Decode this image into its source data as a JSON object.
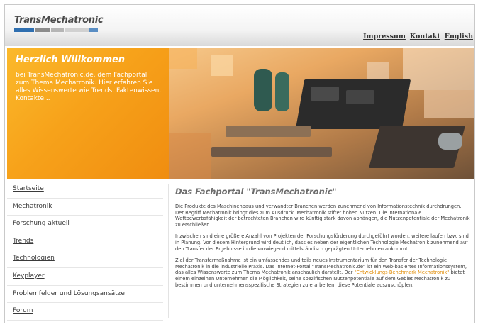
{
  "header": {
    "logo_text": "TransMechatronic",
    "links": [
      "Impressum",
      "Kontakt",
      "English"
    ]
  },
  "banner": {
    "title": "Herzlich Willkommen",
    "text": "bei TransMechatronic.de, dem Fachportal zum Thema Mechatronik. Hier erfahren Sie alles Wissenswerte wie Trends, Faktenwissen, Kontakte..."
  },
  "nav": {
    "items": [
      "Startseite",
      "Mechatronik",
      "Forschung aktuell",
      "Trends",
      "Technologien",
      "Keyplayer",
      "Problemfelder und Lösungsansätze",
      "Forum"
    ]
  },
  "content": {
    "title": "Das Fachportal \"TransMechatronic\"",
    "paragraph1": "Die Produkte des Maschinenbaus und verwandter Branchen werden zunehmend von Informationstechnik durchdrungen. Der Begriff Mechatronik bringt dies zum Ausdruck. Mechatronik stiftet hohen Nutzen. Die internationale Wettbewerbsfähigkeit der betrachteten Branchen wird künftig stark davon abhängen, die Nutzenpotentiale der Mechatronik zu erschließen.",
    "paragraph2": "Inzwischen sind eine größere Anzahl von Projekten der Forschungsförderung durchgeführt worden, weitere laufen bzw. sind in Planung. Vor diesem Hintergrund wird deutlich, dass es neben der eigentlichen Technologie Mechatronik zunehmend auf den Transfer der Ergebnisse in die vorwiegend mittelständisch geprägten Unternehmen ankommt.",
    "paragraph3_before": "Ziel der Transfermaßnahme ist ein umfassendes und teils neues Instrumentarium für den Transfer der Technologie Mechatronik in die industrielle Praxis. Das Internet-Portal \"TransMechatronic.de\" ist ein Web-basiertes Informationssystem, das alles Wissenswerte zum Thema Mechatronik anschaulich darstellt. Der ",
    "paragraph3_link": "\"Entwicklungs-Benchmark Mechatronik\"",
    "paragraph3_after": " bietet einem einzelnen Unternehmen die Möglichkeit, seine spezifischen Nutzenpotentiale auf dem Gebiet Mechatronik zu bestimmen und unternehmensspezifische Strategien zu erarbeiten, diese Potentiale auszuschöpfen."
  },
  "colors": {
    "accent_orange": "#f7a21a",
    "logo_blue": "#2f6fb0",
    "link_orange": "#e08a00"
  }
}
